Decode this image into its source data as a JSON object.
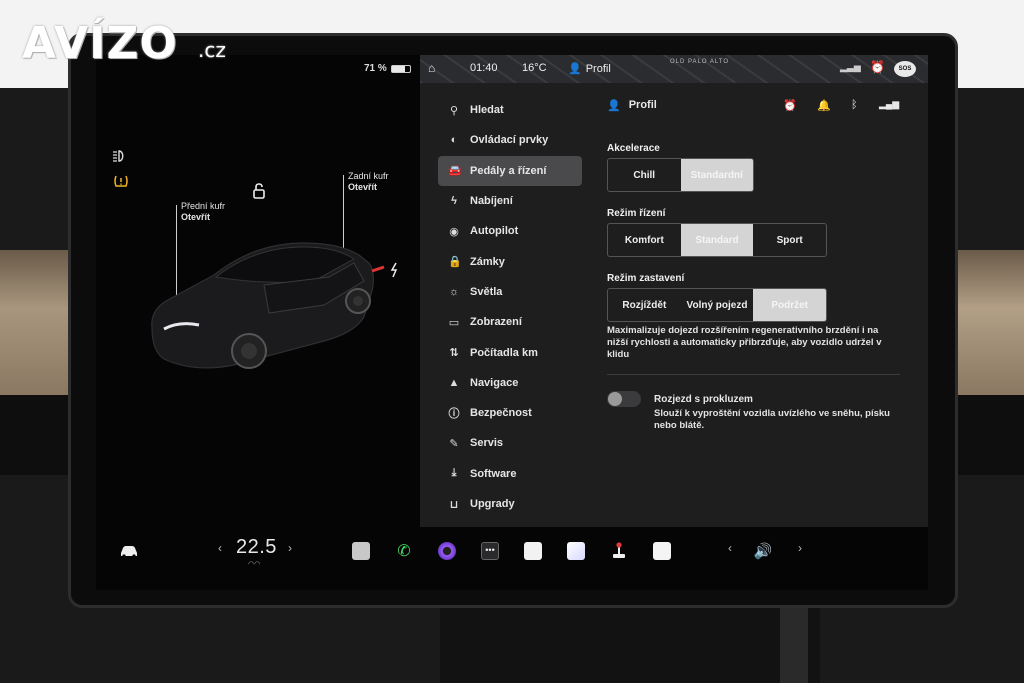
{
  "watermark": {
    "brand": "AVÍZO",
    "tld": ".cz"
  },
  "status_bar": {
    "battery_percent": "71 %",
    "battery_level": 0.71,
    "time": "01:40",
    "temperature": "16°C",
    "profile": "Profil",
    "map_city": "OLD PALO ALTO",
    "sos": "SOS"
  },
  "car_view": {
    "front_trunk": {
      "title": "Přední kufr",
      "action": "Otevřít"
    },
    "rear_trunk": {
      "title": "Zadní kufr",
      "action": "Otevřít"
    },
    "side_icons": [
      "headlights-icon",
      "tire-pressure-warning-icon"
    ]
  },
  "menu": {
    "items": [
      {
        "label": "Hledat",
        "icon": "search-icon"
      },
      {
        "label": "Ovládací prvky",
        "icon": "toggle-icon"
      },
      {
        "label": "Pedály a řízení",
        "icon": "car-icon",
        "active": true
      },
      {
        "label": "Nabíjení",
        "icon": "lightning-icon"
      },
      {
        "label": "Autopilot",
        "icon": "steering-wheel-icon"
      },
      {
        "label": "Zámky",
        "icon": "lock-icon"
      },
      {
        "label": "Světla",
        "icon": "sun-icon"
      },
      {
        "label": "Zobrazení",
        "icon": "display-icon"
      },
      {
        "label": "Počítadla km",
        "icon": "trip-icon"
      },
      {
        "label": "Navigace",
        "icon": "navigation-arrow-icon"
      },
      {
        "label": "Bezpečnost",
        "icon": "info-circle-icon"
      },
      {
        "label": "Servis",
        "icon": "wrench-icon"
      },
      {
        "label": "Software",
        "icon": "download-icon"
      },
      {
        "label": "Upgrady",
        "icon": "shopping-bag-icon"
      }
    ]
  },
  "content": {
    "profile_label": "Profil",
    "acceleration": {
      "label": "Akcelerace",
      "options": [
        "Chill",
        "Standardní"
      ],
      "selected": "Standardní"
    },
    "steering_mode": {
      "label": "Režim řízení",
      "options": [
        "Komfort",
        "Standard",
        "Sport"
      ],
      "selected": "Standard"
    },
    "stopping_mode": {
      "label": "Režim zastavení",
      "options": [
        "Rozjíždět",
        "Volný pojezd",
        "Podržet"
      ],
      "selected": "Podržet"
    },
    "stopping_description": "Maximalizuje dojezd rozšířením regenerativního brzdění i na nižší rychlosti a automaticky přibrzďuje, aby vozidlo udržel v klidu",
    "slip_start": {
      "title": "Rozjezd s prokluzem",
      "description": "Slouží k vyproštění vozidla uvízlého ve sněhu, písku nebo blátě.",
      "enabled": false
    }
  },
  "dock": {
    "cabin_temperature": "22.5",
    "dock_items": [
      "car-icon",
      "music-app-icon",
      "phone-icon",
      "camera-app-icon",
      "more-apps-icon",
      "calendar-app-icon",
      "messages-app-icon",
      "joystick-app-icon",
      "notes-app-icon",
      "volume-icon"
    ]
  },
  "colors": {
    "panel_bg": "#1e1e1f",
    "selected_segment": "#d4d4d4",
    "active_menu": "#4a4a4c",
    "warning_yellow": "#f2b42a",
    "phone_green": "#4cd964",
    "camera_purple": "#9b5cf6",
    "alarm_orange": "#f4a52b",
    "notification_red": "#e03a3a"
  }
}
